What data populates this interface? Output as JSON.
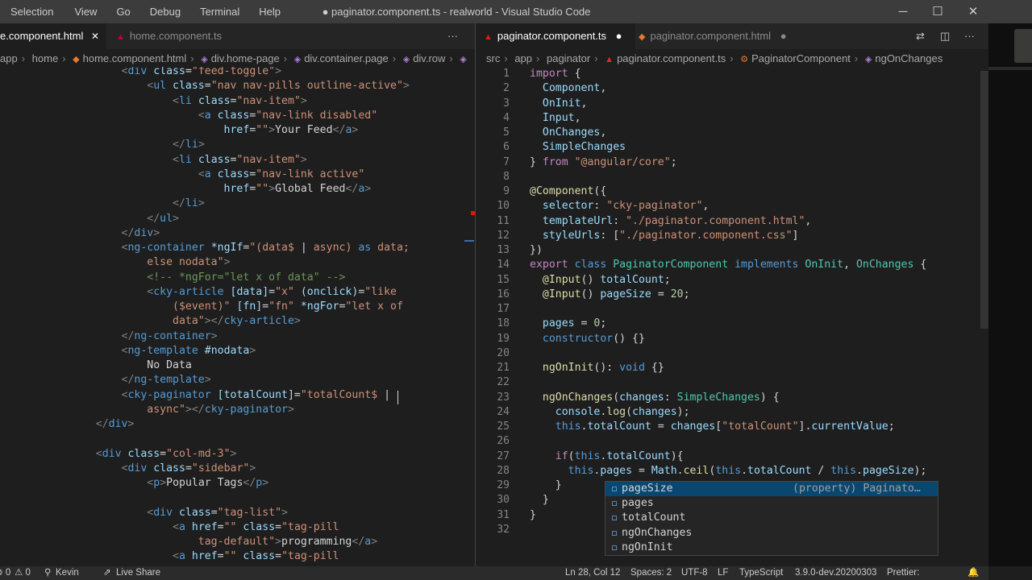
{
  "menu": [
    "Selection",
    "View",
    "Go",
    "Debug",
    "Terminal",
    "Help"
  ],
  "window_title": "● paginator.component.ts - realworld - Visual Studio Code",
  "window_controls": {
    "minimize": "─",
    "maximize": "☐",
    "close": "✕"
  },
  "left_tabs": [
    {
      "label": "e.component.html",
      "icon": "html-icon",
      "close": "✕"
    },
    {
      "label": "home.component.ts",
      "icon": "angular-icon"
    }
  ],
  "left_tabs_more": "···",
  "right_tabs": [
    {
      "label": "paginator.component.ts",
      "icon": "angular-icon",
      "dirty": "●"
    },
    {
      "label": "paginator.component.html",
      "icon": "html-icon",
      "dirty": "●"
    }
  ],
  "editor_actions": [
    "⇄",
    "◫",
    "···"
  ],
  "left_breadcrumbs": [
    "app",
    "home",
    "home.component.html",
    "div.home-page",
    "div.container.page",
    "div.row",
    ""
  ],
  "right_breadcrumbs": [
    "src",
    "app",
    "paginator",
    "paginator.component.ts",
    "PaginatorComponent",
    "ngOnChanges"
  ],
  "left_code": [
    [
      [
        "tag",
        "        <"
      ],
      [
        "el",
        "div "
      ],
      [
        "at",
        "class"
      ],
      [
        "p",
        "="
      ],
      [
        "s",
        "\"feed-toggle\""
      ],
      [
        "tag",
        ">"
      ]
    ],
    [
      [
        "tag",
        "            <"
      ],
      [
        "el",
        "ul "
      ],
      [
        "at",
        "class"
      ],
      [
        "p",
        "="
      ],
      [
        "s",
        "\"nav nav-pills outline-active\""
      ],
      [
        "tag",
        ">"
      ]
    ],
    [
      [
        "tag",
        "                <"
      ],
      [
        "el",
        "li "
      ],
      [
        "at",
        "class"
      ],
      [
        "p",
        "="
      ],
      [
        "s",
        "\"nav-item\""
      ],
      [
        "tag",
        ">"
      ]
    ],
    [
      [
        "tag",
        "                    <"
      ],
      [
        "el",
        "a "
      ],
      [
        "at",
        "class"
      ],
      [
        "p",
        "="
      ],
      [
        "s",
        "\"nav-link disabled\""
      ]
    ],
    [
      [
        "at",
        "                        href"
      ],
      [
        "p",
        "="
      ],
      [
        "s",
        "\"\""
      ],
      [
        "tag",
        ">"
      ],
      [
        "p",
        "Your Feed"
      ],
      [
        "tag",
        "</"
      ],
      [
        "el",
        "a"
      ],
      [
        "tag",
        ">"
      ]
    ],
    [
      [
        "tag",
        "                </"
      ],
      [
        "el",
        "li"
      ],
      [
        "tag",
        ">"
      ]
    ],
    [
      [
        "tag",
        "                <"
      ],
      [
        "el",
        "li "
      ],
      [
        "at",
        "class"
      ],
      [
        "p",
        "="
      ],
      [
        "s",
        "\"nav-item\""
      ],
      [
        "tag",
        ">"
      ]
    ],
    [
      [
        "tag",
        "                    <"
      ],
      [
        "el",
        "a "
      ],
      [
        "at",
        "class"
      ],
      [
        "p",
        "="
      ],
      [
        "s",
        "\"nav-link active\""
      ]
    ],
    [
      [
        "at",
        "                        href"
      ],
      [
        "p",
        "="
      ],
      [
        "s",
        "\"\""
      ],
      [
        "tag",
        ">"
      ],
      [
        "p",
        "Global Feed"
      ],
      [
        "tag",
        "</"
      ],
      [
        "el",
        "a"
      ],
      [
        "tag",
        ">"
      ]
    ],
    [
      [
        "tag",
        "                </"
      ],
      [
        "el",
        "li"
      ],
      [
        "tag",
        ">"
      ]
    ],
    [
      [
        "tag",
        "            </"
      ],
      [
        "el",
        "ul"
      ],
      [
        "tag",
        ">"
      ]
    ],
    [
      [
        "tag",
        "        </"
      ],
      [
        "el",
        "div"
      ],
      [
        "tag",
        ">"
      ]
    ],
    [
      [
        "tag",
        "        <"
      ],
      [
        "el",
        "ng-container "
      ],
      [
        "at",
        "*ngIf"
      ],
      [
        "p",
        "="
      ],
      [
        "s",
        "\"(data$ "
      ],
      [
        "p",
        "| "
      ],
      [
        "s",
        "async) "
      ],
      [
        "k1",
        "as "
      ],
      [
        "s",
        "data;"
      ]
    ],
    [
      [
        "s",
        "            else nodata\""
      ],
      [
        "tag",
        ">"
      ]
    ],
    [
      [
        "c",
        "            <!-- *ngFor=\"let x of data\" -->"
      ]
    ],
    [
      [
        "tag",
        "            <"
      ],
      [
        "el",
        "cky-article "
      ],
      [
        "at",
        "[data]"
      ],
      [
        "p",
        "="
      ],
      [
        "s",
        "\"x\" "
      ],
      [
        "at",
        "(onclick)"
      ],
      [
        "p",
        "="
      ],
      [
        "s",
        "\"like"
      ]
    ],
    [
      [
        "s",
        "                ($event)\" "
      ],
      [
        "at",
        "[fn]"
      ],
      [
        "p",
        "="
      ],
      [
        "s",
        "\"fn\" "
      ],
      [
        "at",
        "*ngFor"
      ],
      [
        "p",
        "="
      ],
      [
        "s",
        "\"let x of"
      ]
    ],
    [
      [
        "s",
        "                data\""
      ],
      [
        "tag",
        "></"
      ],
      [
        "el",
        "cky-article"
      ],
      [
        "tag",
        ">"
      ]
    ],
    [
      [
        "tag",
        "        </"
      ],
      [
        "el",
        "ng-container"
      ],
      [
        "tag",
        ">"
      ]
    ],
    [
      [
        "tag",
        "        <"
      ],
      [
        "el",
        "ng-template "
      ],
      [
        "at",
        "#nodata"
      ],
      [
        "tag",
        ">"
      ]
    ],
    [
      [
        "p",
        "            No Data"
      ]
    ],
    [
      [
        "tag",
        "        </"
      ],
      [
        "el",
        "ng-template"
      ],
      [
        "tag",
        ">"
      ]
    ],
    [
      [
        "tag",
        "        <"
      ],
      [
        "el",
        "cky-paginator "
      ],
      [
        "at",
        "[totalCount]"
      ],
      [
        "p",
        "="
      ],
      [
        "s",
        "\"totalCount$ "
      ],
      [
        "p",
        "|"
      ]
    ],
    [
      [
        "s",
        "            async\""
      ],
      [
        "tag",
        "></"
      ],
      [
        "el",
        "cky-paginator"
      ],
      [
        "tag",
        ">"
      ]
    ],
    [
      [
        "tag",
        "    </"
      ],
      [
        "el",
        "div"
      ],
      [
        "tag",
        ">"
      ]
    ],
    [
      [
        "p",
        ""
      ]
    ],
    [
      [
        "tag",
        "    <"
      ],
      [
        "el",
        "div "
      ],
      [
        "at",
        "class"
      ],
      [
        "p",
        "="
      ],
      [
        "s",
        "\"col-md-3\""
      ],
      [
        "tag",
        ">"
      ]
    ],
    [
      [
        "tag",
        "        <"
      ],
      [
        "el",
        "div "
      ],
      [
        "at",
        "class"
      ],
      [
        "p",
        "="
      ],
      [
        "s",
        "\"sidebar\""
      ],
      [
        "tag",
        ">"
      ]
    ],
    [
      [
        "tag",
        "            <"
      ],
      [
        "el",
        "p"
      ],
      [
        "tag",
        ">"
      ],
      [
        "p",
        "Popular Tags"
      ],
      [
        "tag",
        "</"
      ],
      [
        "el",
        "p"
      ],
      [
        "tag",
        ">"
      ]
    ],
    [
      [
        "p",
        ""
      ]
    ],
    [
      [
        "tag",
        "            <"
      ],
      [
        "el",
        "div "
      ],
      [
        "at",
        "class"
      ],
      [
        "p",
        "="
      ],
      [
        "s",
        "\"tag-list\""
      ],
      [
        "tag",
        ">"
      ]
    ],
    [
      [
        "tag",
        "                <"
      ],
      [
        "el",
        "a "
      ],
      [
        "at",
        "href"
      ],
      [
        "p",
        "="
      ],
      [
        "s",
        "\"\" "
      ],
      [
        "at",
        "class"
      ],
      [
        "p",
        "="
      ],
      [
        "s",
        "\"tag-pill"
      ]
    ],
    [
      [
        "s",
        "                    tag-default\""
      ],
      [
        "tag",
        ">"
      ],
      [
        "p",
        "programming"
      ],
      [
        "tag",
        "</"
      ],
      [
        "el",
        "a"
      ],
      [
        "tag",
        ">"
      ]
    ],
    [
      [
        "tag",
        "                <"
      ],
      [
        "el",
        "a "
      ],
      [
        "at",
        "href"
      ],
      [
        "p",
        "="
      ],
      [
        "s",
        "\"\" "
      ],
      [
        "at",
        "class"
      ],
      [
        "p",
        "="
      ],
      [
        "s",
        "\"tag-pill"
      ]
    ]
  ],
  "right_code": [
    [
      [
        "k2",
        "import "
      ],
      [
        "p",
        "{"
      ]
    ],
    [
      [
        "t",
        "  Component"
      ],
      [
        "p",
        ","
      ]
    ],
    [
      [
        "t",
        "  OnInit"
      ],
      [
        "p",
        ","
      ]
    ],
    [
      [
        "t",
        "  Input"
      ],
      [
        "p",
        ","
      ]
    ],
    [
      [
        "t",
        "  OnChanges"
      ],
      [
        "p",
        ","
      ]
    ],
    [
      [
        "t",
        "  SimpleChanges"
      ]
    ],
    [
      [
        "p",
        "} "
      ],
      [
        "k2",
        "from "
      ],
      [
        "s",
        "\"@angular/core\""
      ],
      [
        "p",
        ";"
      ]
    ],
    [
      [
        "p",
        ""
      ]
    ],
    [
      [
        "f",
        "@Component"
      ],
      [
        "p",
        "({"
      ]
    ],
    [
      [
        "t",
        "  selector"
      ],
      [
        "p",
        ": "
      ],
      [
        "s",
        "\"cky-paginator\""
      ],
      [
        "p",
        ","
      ]
    ],
    [
      [
        "t",
        "  templateUrl"
      ],
      [
        "p",
        ": "
      ],
      [
        "s",
        "\"./paginator.component.html\""
      ],
      [
        "p",
        ","
      ]
    ],
    [
      [
        "t",
        "  styleUrls"
      ],
      [
        "p",
        ": ["
      ],
      [
        "s",
        "\"./paginator.component.css\""
      ],
      [
        "p",
        "]"
      ]
    ],
    [
      [
        "p",
        "})"
      ]
    ],
    [
      [
        "k2",
        "export "
      ],
      [
        "k1",
        "class "
      ],
      [
        "ty",
        "PaginatorComponent "
      ],
      [
        "k1",
        "implements "
      ],
      [
        "ty",
        "OnInit"
      ],
      [
        "p",
        ", "
      ],
      [
        "ty",
        "OnChanges "
      ],
      [
        "p",
        "{"
      ]
    ],
    [
      [
        "f",
        "  @Input"
      ],
      [
        "p",
        "() "
      ],
      [
        "t",
        "totalCount"
      ],
      [
        "p",
        ";"
      ]
    ],
    [
      [
        "f",
        "  @Input"
      ],
      [
        "p",
        "() "
      ],
      [
        "t",
        "pageSize "
      ],
      [
        "p",
        "= "
      ],
      [
        "n",
        "20"
      ],
      [
        "p",
        ";"
      ]
    ],
    [
      [
        "p",
        ""
      ]
    ],
    [
      [
        "t",
        "  pages "
      ],
      [
        "p",
        "= "
      ],
      [
        "n",
        "0"
      ],
      [
        "p",
        ";"
      ]
    ],
    [
      [
        "k1",
        "  constructor"
      ],
      [
        "p",
        "() {}"
      ]
    ],
    [
      [
        "p",
        ""
      ]
    ],
    [
      [
        "f",
        "  ngOnInit"
      ],
      [
        "p",
        "(): "
      ],
      [
        "k1",
        "void "
      ],
      [
        "p",
        "{}"
      ]
    ],
    [
      [
        "p",
        ""
      ]
    ],
    [
      [
        "f",
        "  ngOnChanges"
      ],
      [
        "p",
        "("
      ],
      [
        "t",
        "changes"
      ],
      [
        "p",
        ": "
      ],
      [
        "ty",
        "SimpleChanges"
      ],
      [
        "p",
        ") {"
      ]
    ],
    [
      [
        "t",
        "    console"
      ],
      [
        "p",
        "."
      ],
      [
        "f",
        "log"
      ],
      [
        "p",
        "("
      ],
      [
        "t",
        "changes"
      ],
      [
        "p",
        ");"
      ]
    ],
    [
      [
        "k1",
        "    this"
      ],
      [
        "p",
        "."
      ],
      [
        "t",
        "totalCount "
      ],
      [
        "p",
        "= "
      ],
      [
        "t",
        "changes"
      ],
      [
        "p",
        "["
      ],
      [
        "s",
        "\"totalCount\""
      ],
      [
        "p",
        "]."
      ],
      [
        "t",
        "currentValue"
      ],
      [
        "p",
        ";"
      ]
    ],
    [
      [
        "p",
        ""
      ]
    ],
    [
      [
        "k2",
        "    if"
      ],
      [
        "p",
        "("
      ],
      [
        "k1",
        "this"
      ],
      [
        "p",
        "."
      ],
      [
        "t",
        "totalCount"
      ],
      [
        "p",
        "){"
      ]
    ],
    [
      [
        "k1",
        "      this"
      ],
      [
        "p",
        "."
      ],
      [
        "t",
        "pages "
      ],
      [
        "p",
        "= "
      ],
      [
        "t",
        "Math"
      ],
      [
        "p",
        "."
      ],
      [
        "f",
        "ceil"
      ],
      [
        "p",
        "("
      ],
      [
        "k1",
        "this"
      ],
      [
        "p",
        "."
      ],
      [
        "t",
        "totalCount "
      ],
      [
        "p",
        "/ "
      ],
      [
        "k1",
        "this"
      ],
      [
        "p",
        "."
      ],
      [
        "t",
        "pageSize"
      ],
      [
        "p",
        ");"
      ]
    ],
    [
      [
        "p",
        "    }"
      ]
    ],
    [
      [
        "p",
        "  }"
      ]
    ],
    [
      [
        "p",
        "}"
      ]
    ],
    [
      [
        "p",
        ""
      ]
    ]
  ],
  "suggestions": [
    {
      "label": "pageSize",
      "detail": "(property) Paginato…",
      "selected": true
    },
    {
      "label": "pages",
      "detail": ""
    },
    {
      "label": "totalCount",
      "detail": ""
    },
    {
      "label": "ngOnChanges",
      "detail": ""
    },
    {
      "label": "ngOnInit",
      "detail": ""
    }
  ],
  "status": {
    "errors": "⊗ 0",
    "warnings": "⚠ 0",
    "user": "Kevin",
    "live_share": "Live Share",
    "position": "Ln 28, Col 12",
    "spaces": "Spaces: 2",
    "encoding": "UTF-8",
    "eol": "LF",
    "language": "TypeScript",
    "version": "3.9.0-dev.20200303",
    "prettier": "Prettier:",
    "bell": "🔔"
  }
}
